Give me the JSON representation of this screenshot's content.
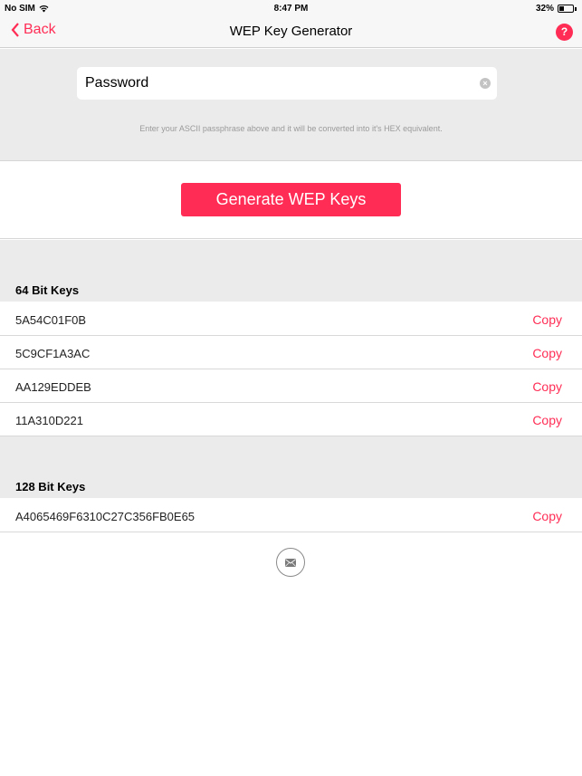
{
  "status_bar": {
    "carrier": "No SIM",
    "time": "8:47 PM",
    "battery": "32%",
    "battery_level": 0.32
  },
  "nav": {
    "back_label": "Back",
    "title": "WEP Key Generator",
    "help_label": "?"
  },
  "input": {
    "value": "Password",
    "hint": "Enter your ASCII passphrase above and it will be converted into it's HEX equivalent."
  },
  "generate_button": "Generate WEP Keys",
  "sections": [
    {
      "title": "64 Bit Keys",
      "keys": [
        "5A54C01F0B",
        "5C9CF1A3AC",
        "AA129EDDEB",
        "11A310D221"
      ]
    },
    {
      "title": "128 Bit Keys",
      "keys": [
        "A4065469F6310C27C356FB0E65"
      ]
    }
  ],
  "copy_label": "Copy",
  "colors": {
    "accent": "#ff2d55",
    "section_bg": "#ebebeb"
  }
}
